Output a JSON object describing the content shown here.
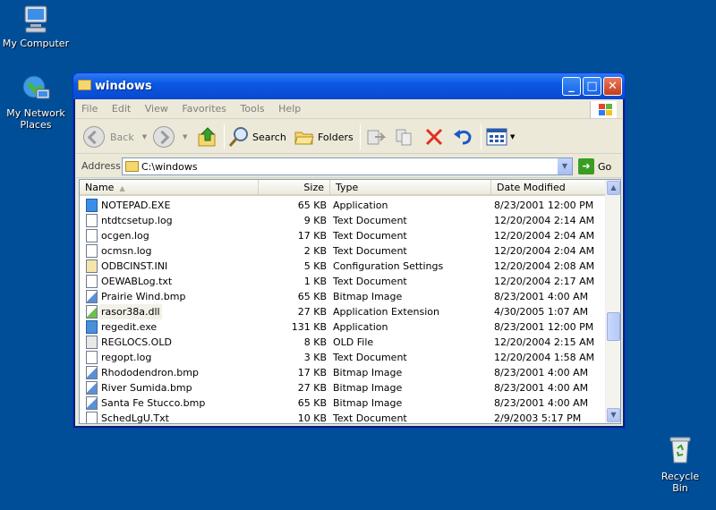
{
  "desktop": {
    "icons": [
      {
        "label": "My Computer",
        "icon": "my-computer-icon"
      },
      {
        "label": "My Network Places",
        "icon": "network-places-icon"
      },
      {
        "label": "Recycle Bin",
        "icon": "recycle-bin-icon"
      }
    ]
  },
  "window": {
    "title": "windows",
    "controls": {
      "minimize": "_",
      "maximize": "□",
      "close": "✕"
    }
  },
  "menubar": {
    "items": [
      "File",
      "Edit",
      "View",
      "Favorites",
      "Tools",
      "Help"
    ]
  },
  "toolbar": {
    "back_label": "Back",
    "search_label": "Search",
    "folders_label": "Folders"
  },
  "address": {
    "label": "Address",
    "value": "C:\\windows",
    "go_label": "Go"
  },
  "columns": {
    "name": "Name",
    "size": "Size",
    "type": "Type",
    "date": "Date Modified"
  },
  "files": [
    {
      "name": "NOTEPAD.EXE",
      "size": "65 KB",
      "type": "Application",
      "date": "8/23/2001 12:00 PM",
      "icon": "application-icon"
    },
    {
      "name": "ntdtcsetup.log",
      "size": "9 KB",
      "type": "Text Document",
      "date": "12/20/2004 2:14 AM",
      "icon": "text-document-icon"
    },
    {
      "name": "ocgen.log",
      "size": "17 KB",
      "type": "Text Document",
      "date": "12/20/2004 2:04 AM",
      "icon": "text-document-icon"
    },
    {
      "name": "ocmsn.log",
      "size": "2 KB",
      "type": "Text Document",
      "date": "12/20/2004 2:04 AM",
      "icon": "text-document-icon"
    },
    {
      "name": "ODBCINST.INI",
      "size": "5 KB",
      "type": "Configuration Settings",
      "date": "12/20/2004 2:08 AM",
      "icon": "settings-file-icon"
    },
    {
      "name": "OEWABLog.txt",
      "size": "1 KB",
      "type": "Text Document",
      "date": "12/20/2004 2:17 AM",
      "icon": "text-document-icon"
    },
    {
      "name": "Prairie Wind.bmp",
      "size": "65 KB",
      "type": "Bitmap Image",
      "date": "8/23/2001 4:00 AM",
      "icon": "bitmap-icon"
    },
    {
      "name": "rasor38a.dll",
      "size": "27 KB",
      "type": "Application Extension",
      "date": "4/30/2005 1:07 AM",
      "icon": "dll-icon"
    },
    {
      "name": "regedit.exe",
      "size": "131 KB",
      "type": "Application",
      "date": "8/23/2001 12:00 PM",
      "icon": "regedit-icon"
    },
    {
      "name": "REGLOCS.OLD",
      "size": "8 KB",
      "type": "OLD File",
      "date": "12/20/2004 2:15 AM",
      "icon": "generic-file-icon"
    },
    {
      "name": "regopt.log",
      "size": "3 KB",
      "type": "Text Document",
      "date": "12/20/2004 1:58 AM",
      "icon": "text-document-icon"
    },
    {
      "name": "Rhododendron.bmp",
      "size": "17 KB",
      "type": "Bitmap Image",
      "date": "8/23/2001 4:00 AM",
      "icon": "bitmap-icon"
    },
    {
      "name": "River Sumida.bmp",
      "size": "27 KB",
      "type": "Bitmap Image",
      "date": "8/23/2001 4:00 AM",
      "icon": "bitmap-icon"
    },
    {
      "name": "Santa Fe Stucco.bmp",
      "size": "65 KB",
      "type": "Bitmap Image",
      "date": "8/23/2001 4:00 AM",
      "icon": "bitmap-icon"
    },
    {
      "name": "SchedLgU.Txt",
      "size": "10 KB",
      "type": "Text Document",
      "date": "2/9/2003 5:17 PM",
      "icon": "text-document-icon"
    }
  ],
  "colors": {
    "desktop": "#004e98",
    "titlebar": "#0a4ed6",
    "chrome": "#ece9d8"
  }
}
